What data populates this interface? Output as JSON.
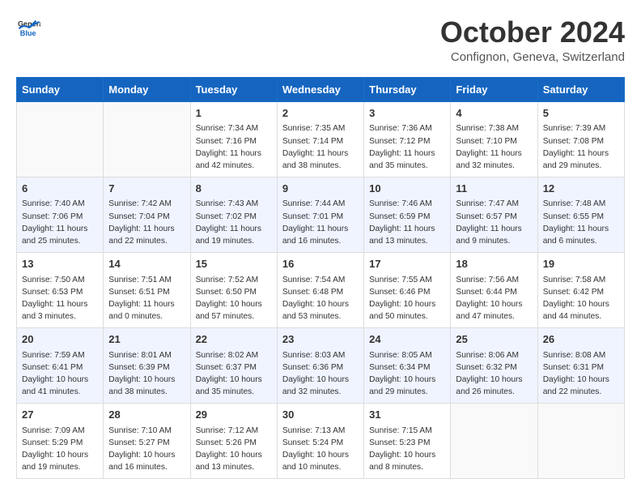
{
  "header": {
    "logo_general": "General",
    "logo_blue": "Blue",
    "month_title": "October 2024",
    "location": "Confignon, Geneva, Switzerland"
  },
  "days_of_week": [
    "Sunday",
    "Monday",
    "Tuesday",
    "Wednesday",
    "Thursday",
    "Friday",
    "Saturday"
  ],
  "weeks": [
    [
      {
        "day": "",
        "sunrise": "",
        "sunset": "",
        "daylight": ""
      },
      {
        "day": "",
        "sunrise": "",
        "sunset": "",
        "daylight": ""
      },
      {
        "day": "1",
        "sunrise": "Sunrise: 7:34 AM",
        "sunset": "Sunset: 7:16 PM",
        "daylight": "Daylight: 11 hours and 42 minutes."
      },
      {
        "day": "2",
        "sunrise": "Sunrise: 7:35 AM",
        "sunset": "Sunset: 7:14 PM",
        "daylight": "Daylight: 11 hours and 38 minutes."
      },
      {
        "day": "3",
        "sunrise": "Sunrise: 7:36 AM",
        "sunset": "Sunset: 7:12 PM",
        "daylight": "Daylight: 11 hours and 35 minutes."
      },
      {
        "day": "4",
        "sunrise": "Sunrise: 7:38 AM",
        "sunset": "Sunset: 7:10 PM",
        "daylight": "Daylight: 11 hours and 32 minutes."
      },
      {
        "day": "5",
        "sunrise": "Sunrise: 7:39 AM",
        "sunset": "Sunset: 7:08 PM",
        "daylight": "Daylight: 11 hours and 29 minutes."
      }
    ],
    [
      {
        "day": "6",
        "sunrise": "Sunrise: 7:40 AM",
        "sunset": "Sunset: 7:06 PM",
        "daylight": "Daylight: 11 hours and 25 minutes."
      },
      {
        "day": "7",
        "sunrise": "Sunrise: 7:42 AM",
        "sunset": "Sunset: 7:04 PM",
        "daylight": "Daylight: 11 hours and 22 minutes."
      },
      {
        "day": "8",
        "sunrise": "Sunrise: 7:43 AM",
        "sunset": "Sunset: 7:02 PM",
        "daylight": "Daylight: 11 hours and 19 minutes."
      },
      {
        "day": "9",
        "sunrise": "Sunrise: 7:44 AM",
        "sunset": "Sunset: 7:01 PM",
        "daylight": "Daylight: 11 hours and 16 minutes."
      },
      {
        "day": "10",
        "sunrise": "Sunrise: 7:46 AM",
        "sunset": "Sunset: 6:59 PM",
        "daylight": "Daylight: 11 hours and 13 minutes."
      },
      {
        "day": "11",
        "sunrise": "Sunrise: 7:47 AM",
        "sunset": "Sunset: 6:57 PM",
        "daylight": "Daylight: 11 hours and 9 minutes."
      },
      {
        "day": "12",
        "sunrise": "Sunrise: 7:48 AM",
        "sunset": "Sunset: 6:55 PM",
        "daylight": "Daylight: 11 hours and 6 minutes."
      }
    ],
    [
      {
        "day": "13",
        "sunrise": "Sunrise: 7:50 AM",
        "sunset": "Sunset: 6:53 PM",
        "daylight": "Daylight: 11 hours and 3 minutes."
      },
      {
        "day": "14",
        "sunrise": "Sunrise: 7:51 AM",
        "sunset": "Sunset: 6:51 PM",
        "daylight": "Daylight: 11 hours and 0 minutes."
      },
      {
        "day": "15",
        "sunrise": "Sunrise: 7:52 AM",
        "sunset": "Sunset: 6:50 PM",
        "daylight": "Daylight: 10 hours and 57 minutes."
      },
      {
        "day": "16",
        "sunrise": "Sunrise: 7:54 AM",
        "sunset": "Sunset: 6:48 PM",
        "daylight": "Daylight: 10 hours and 53 minutes."
      },
      {
        "day": "17",
        "sunrise": "Sunrise: 7:55 AM",
        "sunset": "Sunset: 6:46 PM",
        "daylight": "Daylight: 10 hours and 50 minutes."
      },
      {
        "day": "18",
        "sunrise": "Sunrise: 7:56 AM",
        "sunset": "Sunset: 6:44 PM",
        "daylight": "Daylight: 10 hours and 47 minutes."
      },
      {
        "day": "19",
        "sunrise": "Sunrise: 7:58 AM",
        "sunset": "Sunset: 6:42 PM",
        "daylight": "Daylight: 10 hours and 44 minutes."
      }
    ],
    [
      {
        "day": "20",
        "sunrise": "Sunrise: 7:59 AM",
        "sunset": "Sunset: 6:41 PM",
        "daylight": "Daylight: 10 hours and 41 minutes."
      },
      {
        "day": "21",
        "sunrise": "Sunrise: 8:01 AM",
        "sunset": "Sunset: 6:39 PM",
        "daylight": "Daylight: 10 hours and 38 minutes."
      },
      {
        "day": "22",
        "sunrise": "Sunrise: 8:02 AM",
        "sunset": "Sunset: 6:37 PM",
        "daylight": "Daylight: 10 hours and 35 minutes."
      },
      {
        "day": "23",
        "sunrise": "Sunrise: 8:03 AM",
        "sunset": "Sunset: 6:36 PM",
        "daylight": "Daylight: 10 hours and 32 minutes."
      },
      {
        "day": "24",
        "sunrise": "Sunrise: 8:05 AM",
        "sunset": "Sunset: 6:34 PM",
        "daylight": "Daylight: 10 hours and 29 minutes."
      },
      {
        "day": "25",
        "sunrise": "Sunrise: 8:06 AM",
        "sunset": "Sunset: 6:32 PM",
        "daylight": "Daylight: 10 hours and 26 minutes."
      },
      {
        "day": "26",
        "sunrise": "Sunrise: 8:08 AM",
        "sunset": "Sunset: 6:31 PM",
        "daylight": "Daylight: 10 hours and 22 minutes."
      }
    ],
    [
      {
        "day": "27",
        "sunrise": "Sunrise: 7:09 AM",
        "sunset": "Sunset: 5:29 PM",
        "daylight": "Daylight: 10 hours and 19 minutes."
      },
      {
        "day": "28",
        "sunrise": "Sunrise: 7:10 AM",
        "sunset": "Sunset: 5:27 PM",
        "daylight": "Daylight: 10 hours and 16 minutes."
      },
      {
        "day": "29",
        "sunrise": "Sunrise: 7:12 AM",
        "sunset": "Sunset: 5:26 PM",
        "daylight": "Daylight: 10 hours and 13 minutes."
      },
      {
        "day": "30",
        "sunrise": "Sunrise: 7:13 AM",
        "sunset": "Sunset: 5:24 PM",
        "daylight": "Daylight: 10 hours and 10 minutes."
      },
      {
        "day": "31",
        "sunrise": "Sunrise: 7:15 AM",
        "sunset": "Sunset: 5:23 PM",
        "daylight": "Daylight: 10 hours and 8 minutes."
      },
      {
        "day": "",
        "sunrise": "",
        "sunset": "",
        "daylight": ""
      },
      {
        "day": "",
        "sunrise": "",
        "sunset": "",
        "daylight": ""
      }
    ]
  ]
}
